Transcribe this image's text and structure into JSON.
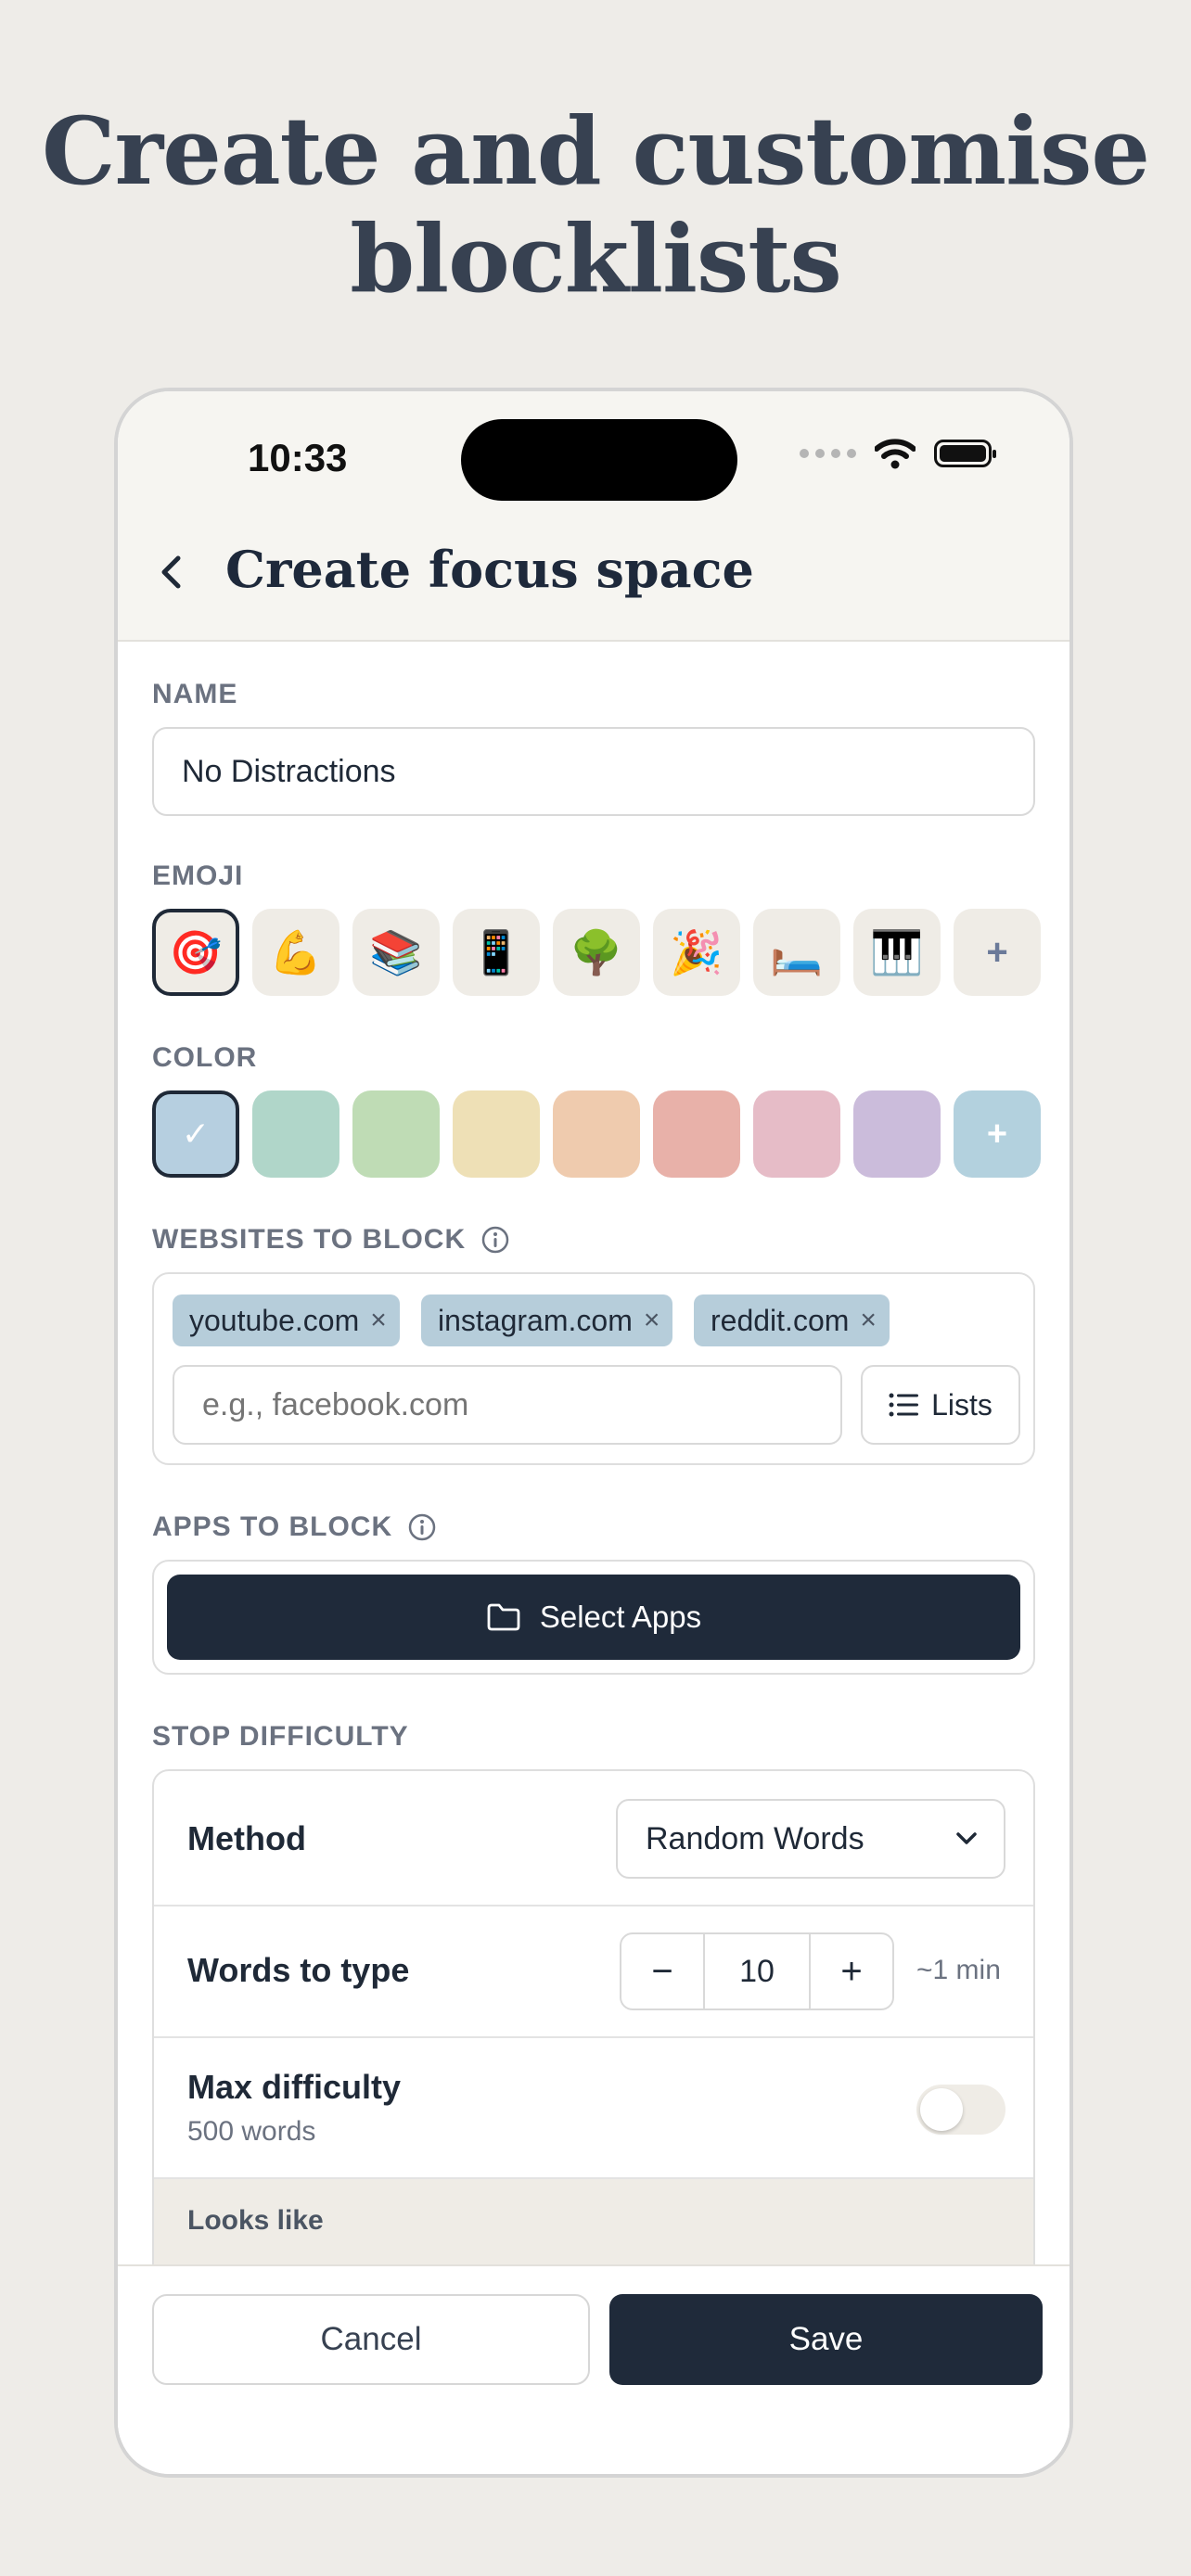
{
  "headline": {
    "line1": "Create and customise",
    "line2": "blocklists"
  },
  "status_bar": {
    "time": "10:33"
  },
  "header": {
    "title": "Create focus space"
  },
  "name": {
    "label": "NAME",
    "value": "No Distractions"
  },
  "emoji": {
    "label": "EMOJI",
    "items": [
      "🎯",
      "💪",
      "📚",
      "📱",
      "🌳",
      "🎉",
      "🛏️",
      "🎹"
    ],
    "add": "+"
  },
  "color": {
    "label": "COLOR",
    "swatches": [
      "#b6cfe0",
      "#b0d6c9",
      "#bfdcb5",
      "#eee0b6",
      "#efcbae",
      "#e8b1a9",
      "#e6bcc7",
      "#cbbcdb"
    ],
    "add_color": "#b3d1de",
    "add": "+",
    "check": "✓"
  },
  "websites": {
    "label": "WEBSITES TO BLOCK",
    "chips": [
      "youtube.com",
      "instagram.com",
      "reddit.com"
    ],
    "remove": "×",
    "placeholder": "e.g., facebook.com",
    "lists_label": "Lists"
  },
  "apps": {
    "label": "APPS TO BLOCK",
    "select_label": "Select Apps"
  },
  "stop_difficulty": {
    "label": "STOP DIFFICULTY",
    "method_label": "Method",
    "method_value": "Random Words",
    "words_label": "Words to type",
    "minus": "−",
    "plus": "+",
    "words_value": "10",
    "words_estimate": "~1 min",
    "max_label": "Max difficulty",
    "max_sub": "500 words",
    "max_enabled": false,
    "looks_like_label": "Looks like"
  },
  "footer": {
    "cancel": "Cancel",
    "save": "Save"
  }
}
